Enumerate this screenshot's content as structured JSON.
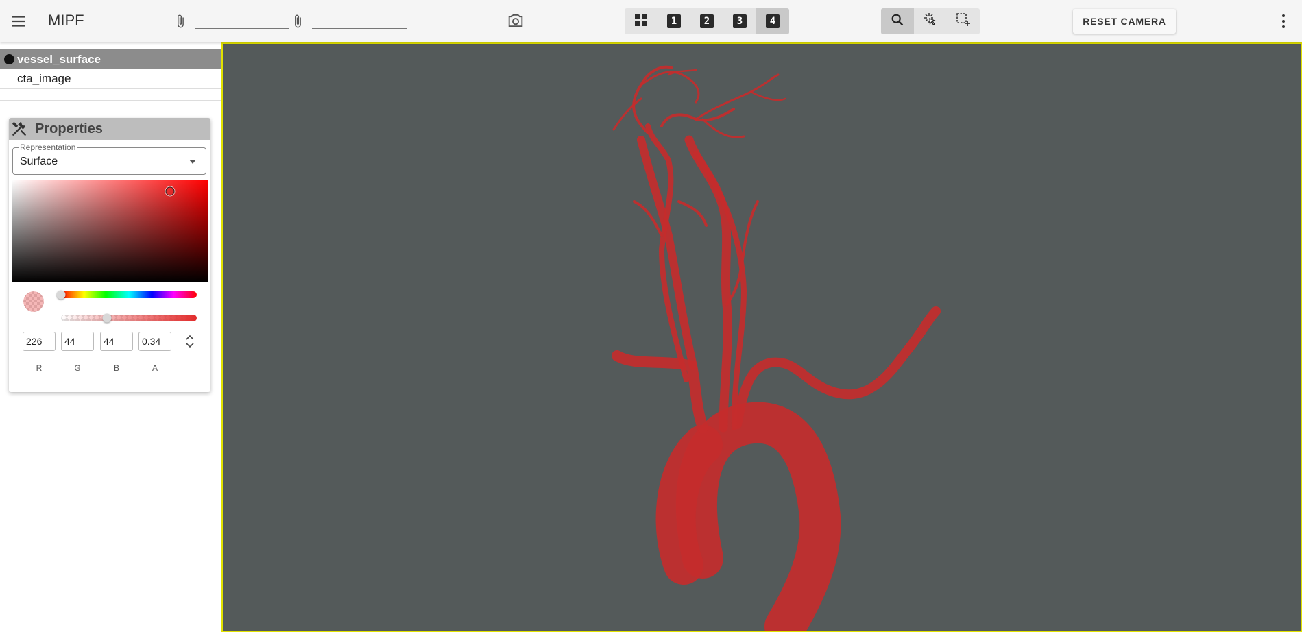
{
  "app": {
    "title": "MIPF"
  },
  "toolbar": {
    "menu_icon": "hamburger-icon",
    "attach_icon": "paperclip-icon",
    "file_field_1": "",
    "file_field_2": "",
    "screenshot_icon": "camera-icon",
    "layout_buttons": [
      {
        "label": "",
        "icon": "grid-layout-icon",
        "active": false
      },
      {
        "label": "1",
        "icon": "layout-1-icon",
        "active": false
      },
      {
        "label": "2",
        "icon": "layout-2-icon",
        "active": false
      },
      {
        "label": "3",
        "icon": "layout-3-icon",
        "active": false
      },
      {
        "label": "4",
        "icon": "layout-4-icon",
        "active": true
      }
    ],
    "tool_buttons": [
      {
        "icon": "search-icon",
        "active": true
      },
      {
        "icon": "select-pointer-icon",
        "active": false
      },
      {
        "icon": "add-selection-box-icon",
        "active": false
      }
    ],
    "reset_camera_label": "RESET CAMERA",
    "more_icon": "more-vert-icon"
  },
  "layers": [
    {
      "label": "vessel_surface",
      "selected": true
    },
    {
      "label": "cta_image",
      "selected": false
    }
  ],
  "properties": {
    "title": "Properties",
    "icon": "wrench-icon",
    "representation": {
      "legend": "Representation",
      "value": "Surface"
    },
    "color": {
      "r": "226",
      "g": "44",
      "b": "44",
      "a": "0.34",
      "hue_position": 0.0,
      "alpha_position": 0.34,
      "hex": "#e22c2c"
    },
    "channel_labels": {
      "r": "R",
      "g": "G",
      "b": "B",
      "a": "A"
    }
  },
  "viewport": {
    "background": "#545a5a",
    "border_color": "#e1e100",
    "surface_color": "#c42d2d"
  }
}
